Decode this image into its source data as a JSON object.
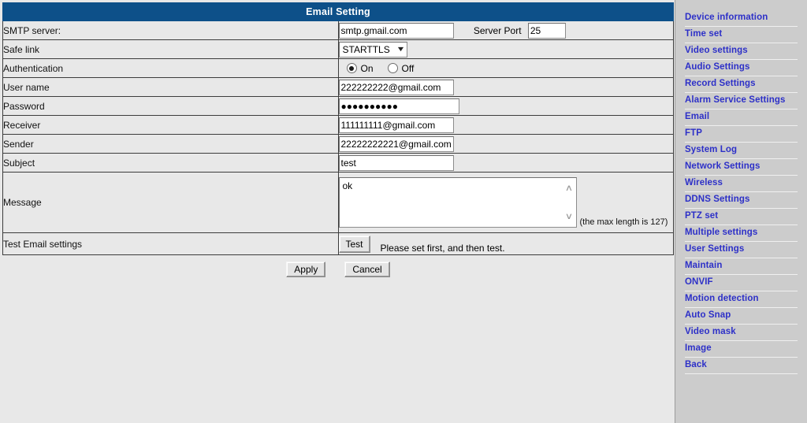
{
  "header": {
    "title": "Email Setting",
    "bar_color": "#0d5089"
  },
  "form": {
    "smtp": {
      "label": "SMTP server:",
      "value": "smtp.gmail.com",
      "port_label": "Server Port",
      "port_value": "25"
    },
    "safe_link": {
      "label": "Safe link",
      "value": "STARTTLS",
      "chevron": "chevron-down-icon"
    },
    "authentication": {
      "label": "Authentication",
      "on_label": "On",
      "off_label": "Off",
      "selected": "On"
    },
    "user_name": {
      "label": "User name",
      "value": "222222222@gmail.com"
    },
    "password": {
      "label": "Password",
      "value": "●●●●●●●●●●"
    },
    "receiver": {
      "label": "Receiver",
      "value": "111111111@gmail.com"
    },
    "sender": {
      "label": "Sender",
      "value": "22222222221@gmail.com"
    },
    "subject": {
      "label": "Subject",
      "value": "test"
    },
    "message": {
      "label": "Message",
      "value": "ok",
      "hint": "(the max length is 127)",
      "scroll_up": "∧",
      "scroll_down": "∨"
    },
    "test_email": {
      "label": "Test Email settings",
      "button_label": "Test",
      "note": "Please set first, and then test."
    }
  },
  "actions": {
    "apply_label": "Apply",
    "cancel_label": "Cancel"
  },
  "sidebar": {
    "items": [
      {
        "label": "Device information"
      },
      {
        "label": "Time set"
      },
      {
        "label": "Video settings"
      },
      {
        "label": "Audio Settings"
      },
      {
        "label": "Record Settings"
      },
      {
        "label": "Alarm Service Settings"
      },
      {
        "label": "Email"
      },
      {
        "label": "FTP"
      },
      {
        "label": "System Log"
      },
      {
        "label": "Network Settings"
      },
      {
        "label": "Wireless"
      },
      {
        "label": "DDNS Settings"
      },
      {
        "label": "PTZ set"
      },
      {
        "label": "Multiple settings"
      },
      {
        "label": "User Settings"
      },
      {
        "label": "Maintain"
      },
      {
        "label": "ONVIF"
      },
      {
        "label": "Motion detection"
      },
      {
        "label": "Auto Snap"
      },
      {
        "label": "Video mask"
      },
      {
        "label": "Image"
      },
      {
        "label": "Back"
      }
    ],
    "link_color": "#2d30c8",
    "background": "#cccccc"
  }
}
